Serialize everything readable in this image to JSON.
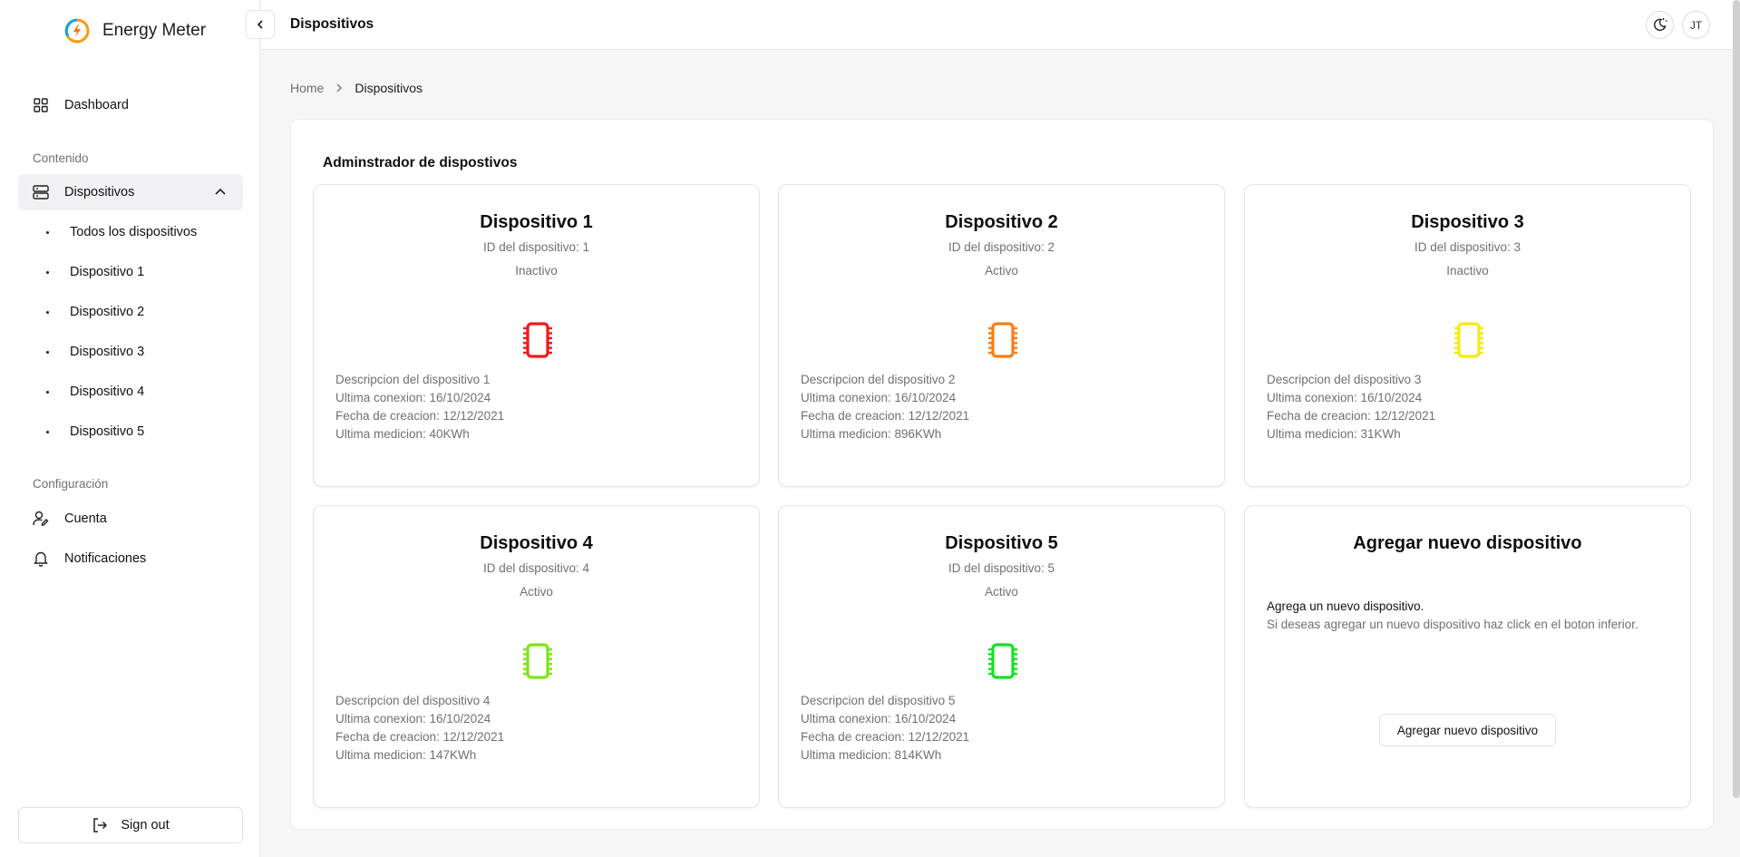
{
  "app": {
    "name": "Energy Meter"
  },
  "sidebar": {
    "dashboard_label": "Dashboard",
    "section_content": "Contenido",
    "devices_label": "Dispositivos",
    "sub_items": [
      {
        "label": "Todos los dispositivos"
      },
      {
        "label": "Dispositivo 1"
      },
      {
        "label": "Dispositivo 2"
      },
      {
        "label": "Dispositivo 3"
      },
      {
        "label": "Dispositivo 4"
      },
      {
        "label": "Dispositivo 5"
      }
    ],
    "section_config": "Configuración",
    "account_label": "Cuenta",
    "notifications_label": "Notificaciones",
    "signout_label": "Sign out"
  },
  "header": {
    "title": "Dispositivos",
    "avatar_initials": "JT",
    "theme_toggle_icon": "moon-sun-icon"
  },
  "breadcrumb": {
    "home": "Home",
    "current": "Dispositivos"
  },
  "panel": {
    "title": "Adminstrador de dispostivos"
  },
  "devices": [
    {
      "name": "Dispositivo 1",
      "id_text": "ID del dispositivo: 1",
      "status": "Inactivo",
      "color": "#ee1b1b",
      "description": "Descripcion del dispositivo 1",
      "last_connection": "Ultima conexion: 16/10/2024",
      "created": "Fecha de creacion: 12/12/2021",
      "last_measure": "Ultima medicion: 40KWh"
    },
    {
      "name": "Dispositivo 2",
      "id_text": "ID del dispositivo: 2",
      "status": "Activo",
      "color": "#f97d16",
      "description": "Descripcion del dispositivo 2",
      "last_connection": "Ultima conexion: 16/10/2024",
      "created": "Fecha de creacion: 12/12/2021",
      "last_measure": "Ultima medicion: 896KWh"
    },
    {
      "name": "Dispositivo 3",
      "id_text": "ID del dispositivo: 3",
      "status": "Inactivo",
      "color": "#f5ea0a",
      "description": "Descripcion del dispositivo 3",
      "last_connection": "Ultima conexion: 16/10/2024",
      "created": "Fecha de creacion: 12/12/2021",
      "last_measure": "Ultima medicion: 31KWh"
    },
    {
      "name": "Dispositivo 4",
      "id_text": "ID del dispositivo: 4",
      "status": "Activo",
      "color": "#7be51a",
      "description": "Descripcion del dispositivo 4",
      "last_connection": "Ultima conexion: 16/10/2024",
      "created": "Fecha de creacion: 12/12/2021",
      "last_measure": "Ultima medicion: 147KWh"
    },
    {
      "name": "Dispositivo 5",
      "id_text": "ID del dispositivo: 5",
      "status": "Activo",
      "color": "#19e025",
      "description": "Descripcion del dispositivo 5",
      "last_connection": "Ultima conexion: 16/10/2024",
      "created": "Fecha de creacion: 12/12/2021",
      "last_measure": "Ultima medicion: 814KWh"
    }
  ],
  "add_card": {
    "title": "Agregar nuevo dispositivo",
    "line1": "Agrega un nuevo dispositivo.",
    "line2": "Si deseas agregar un nuevo dispositivo haz click en el boton inferior.",
    "button_label": "Agregar nuevo dispositivo"
  },
  "icons": [
    "logo-icon",
    "chevron-left-icon",
    "dashboard-grid-icon",
    "device-icon",
    "chevron-up-icon",
    "user-icon",
    "bell-icon",
    "signout-icon",
    "chevron-right-icon",
    "chip-icon"
  ]
}
